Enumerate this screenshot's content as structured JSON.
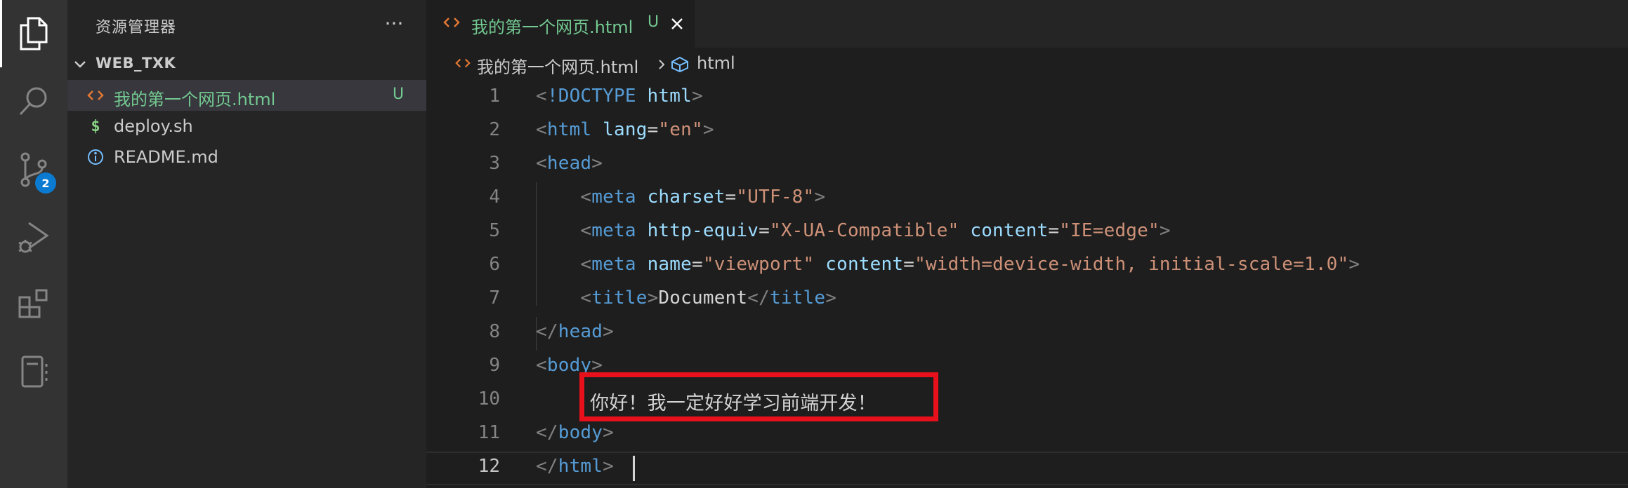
{
  "activity_bar": {
    "items": [
      {
        "name": "explorer",
        "icon": "files-icon",
        "active": true
      },
      {
        "name": "search",
        "icon": "search-icon"
      },
      {
        "name": "source-control",
        "icon": "source-control-icon",
        "badge": "2"
      },
      {
        "name": "run-debug",
        "icon": "run-debug-icon"
      },
      {
        "name": "extensions",
        "icon": "extensions-icon"
      },
      {
        "name": "notebook",
        "icon": "notebook-icon"
      }
    ]
  },
  "sidebar": {
    "title": "资源管理器",
    "more_label": "···",
    "folder": {
      "name": "WEB_TXK",
      "files": [
        {
          "name": "我的第一个网页.html",
          "icon": "html-icon",
          "status": "U",
          "selected": true
        },
        {
          "name": "deploy.sh",
          "icon": "shell-icon",
          "icon_glyph": "$"
        },
        {
          "name": "README.md",
          "icon": "info-icon"
        }
      ]
    }
  },
  "editor": {
    "tab": {
      "label": "我的第一个网页.html",
      "status": "U"
    },
    "breadcrumb": {
      "file": "我的第一个网页.html",
      "symbol": "html"
    },
    "lines": [
      {
        "n": "1"
      },
      {
        "n": "2"
      },
      {
        "n": "3"
      },
      {
        "n": "4"
      },
      {
        "n": "5"
      },
      {
        "n": "6"
      },
      {
        "n": "7"
      },
      {
        "n": "8"
      },
      {
        "n": "9"
      },
      {
        "n": "10"
      },
      {
        "n": "11"
      },
      {
        "n": "12"
      }
    ],
    "code": {
      "l1_doctype": "!DOCTYPE",
      "l1_html": "html",
      "l2_tag": "html",
      "l2_attr": "lang",
      "l2_val": "\"en\"",
      "l3_tag": "head",
      "l4_tag": "meta",
      "l4_attr": "charset",
      "l4_val": "\"UTF-8\"",
      "l5_tag": "meta",
      "l5_attr1": "http-equiv",
      "l5_val1": "\"X-UA-Compatible\"",
      "l5_attr2": "content",
      "l5_val2": "\"IE=edge\"",
      "l6_tag": "meta",
      "l6_attr1": "name",
      "l6_val1": "\"viewport\"",
      "l6_attr2": "content",
      "l6_val2": "\"width=device-width, initial-scale=1.0\"",
      "l7_tag": "title",
      "l7_text": "Document",
      "l7_close": "title",
      "l8_tag": "head",
      "l9_tag": "body",
      "l10_text": "你好！我一定好好学习前端开发！",
      "l11_tag": "body",
      "l12_tag": "html"
    },
    "current_line": "12"
  },
  "colors": {
    "highlight_box": "#e8111b",
    "tag": "#569cd6",
    "attr": "#9cdcfe",
    "string": "#ce9178",
    "untracked": "#73c991"
  }
}
